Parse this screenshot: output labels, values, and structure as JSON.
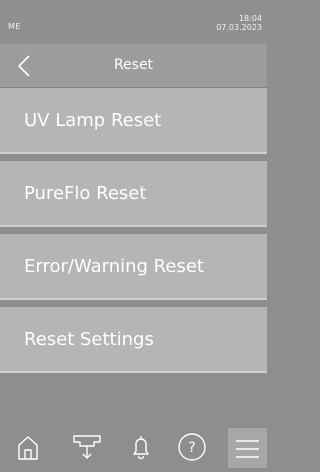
{
  "status": {
    "user": "ME",
    "time": "18:04",
    "date": "07.03.2023"
  },
  "header": {
    "title": "Reset",
    "back_icon": "chevron-left-icon"
  },
  "menu": {
    "items": [
      {
        "label": "UV Lamp Reset"
      },
      {
        "label": "PureFlo Reset"
      },
      {
        "label": "Error/Warning Reset"
      },
      {
        "label": "Reset Settings"
      }
    ]
  },
  "footer": {
    "icons": [
      "home-icon",
      "water-dispense-icon",
      "bell-icon",
      "help-icon",
      "menu-icon"
    ]
  },
  "colors": {
    "background": "#8e8e8e",
    "titlebar": "#9c9c9c",
    "menu_item": "#b5b5b5",
    "text": "#ffffff"
  }
}
